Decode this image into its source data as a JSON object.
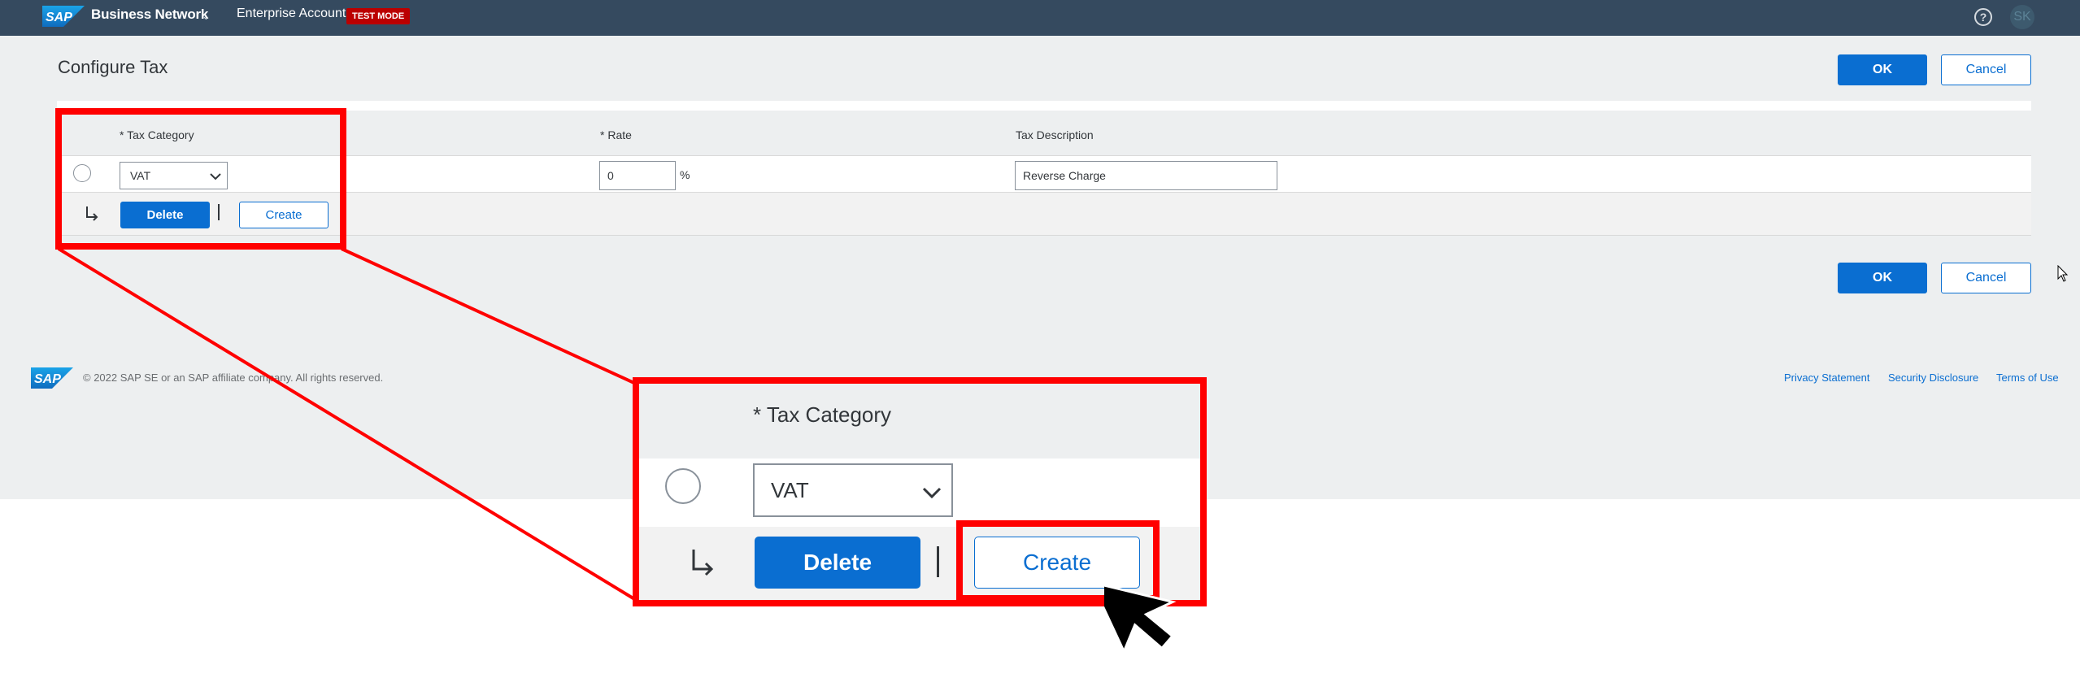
{
  "header": {
    "brand": "Business Network",
    "account": "Enterprise Account",
    "badge": "TEST MODE",
    "logo_text": "SAP",
    "help_symbol": "?",
    "avatar_initials": "SK",
    "brand_caret": "⌄"
  },
  "page": {
    "title": "Configure Tax",
    "ok_label": "OK",
    "cancel_label": "Cancel"
  },
  "table": {
    "headers": {
      "tax_category": "* Tax Category",
      "rate": "* Rate",
      "tax_description": "Tax Description"
    },
    "row": {
      "tax_category": "VAT",
      "rate": "0",
      "rate_unit": "%",
      "tax_description": "Reverse Charge"
    },
    "actions": {
      "delete_label": "Delete",
      "create_label": "Create"
    }
  },
  "footer": {
    "copyright": "© 2022 SAP SE or an SAP affiliate company. All rights reserved.",
    "links": [
      "Privacy Statement",
      "Security Disclosure",
      "Terms of Use"
    ]
  },
  "icons": {
    "help": "question-circle-icon",
    "select": "chevron-down-icon",
    "subrow": "subdirectory-arrow-icon",
    "cursor": "mouse-pointer-icon"
  },
  "colors": {
    "shell": "#354a5f",
    "primary": "#0a6ed1",
    "badge": "#bb0000",
    "highlight": "#ff0000"
  }
}
